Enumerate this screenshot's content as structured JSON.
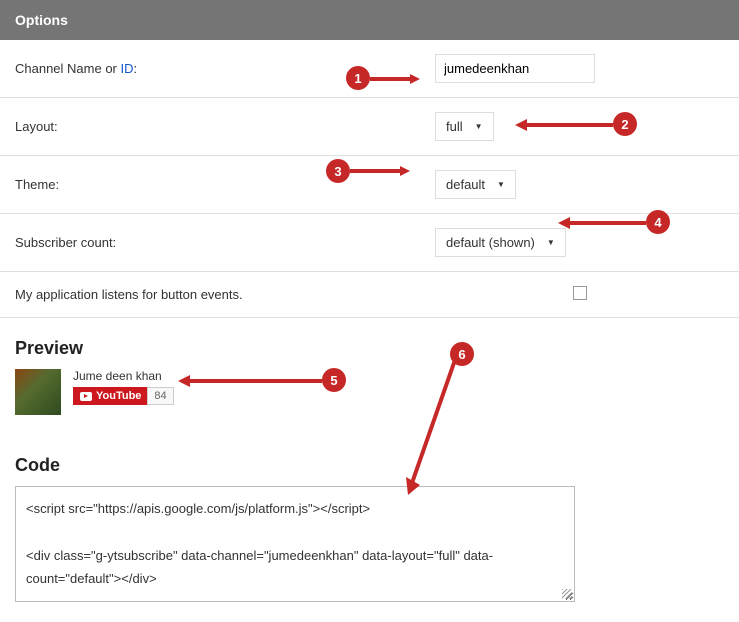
{
  "options": {
    "header": "Options",
    "channel_label_prefix": "Channel Name or ",
    "channel_label_link": "ID",
    "channel_label_suffix": ":",
    "channel_value": "jumedeenkhan",
    "layout_label": "Layout:",
    "layout_value": "full",
    "theme_label": "Theme:",
    "theme_value": "default",
    "subscriber_label": "Subscriber count:",
    "subscriber_value": "default (shown)",
    "listens_label": "My application listens for button events."
  },
  "preview": {
    "title": "Preview",
    "channel_display": "Jume deen khan",
    "button_text": "YouTube",
    "count": "84"
  },
  "code": {
    "title": "Code",
    "line1": "<script src=\"https://apis.google.com/js/platform.js\"></script>",
    "line2": "<div class=\"g-ytsubscribe\" data-channel=\"jumedeenkhan\" data-layout=\"full\" data-count=\"default\"></div>"
  },
  "annotations": {
    "n1": "1",
    "n2": "2",
    "n3": "3",
    "n4": "4",
    "n5": "5",
    "n6": "6"
  }
}
